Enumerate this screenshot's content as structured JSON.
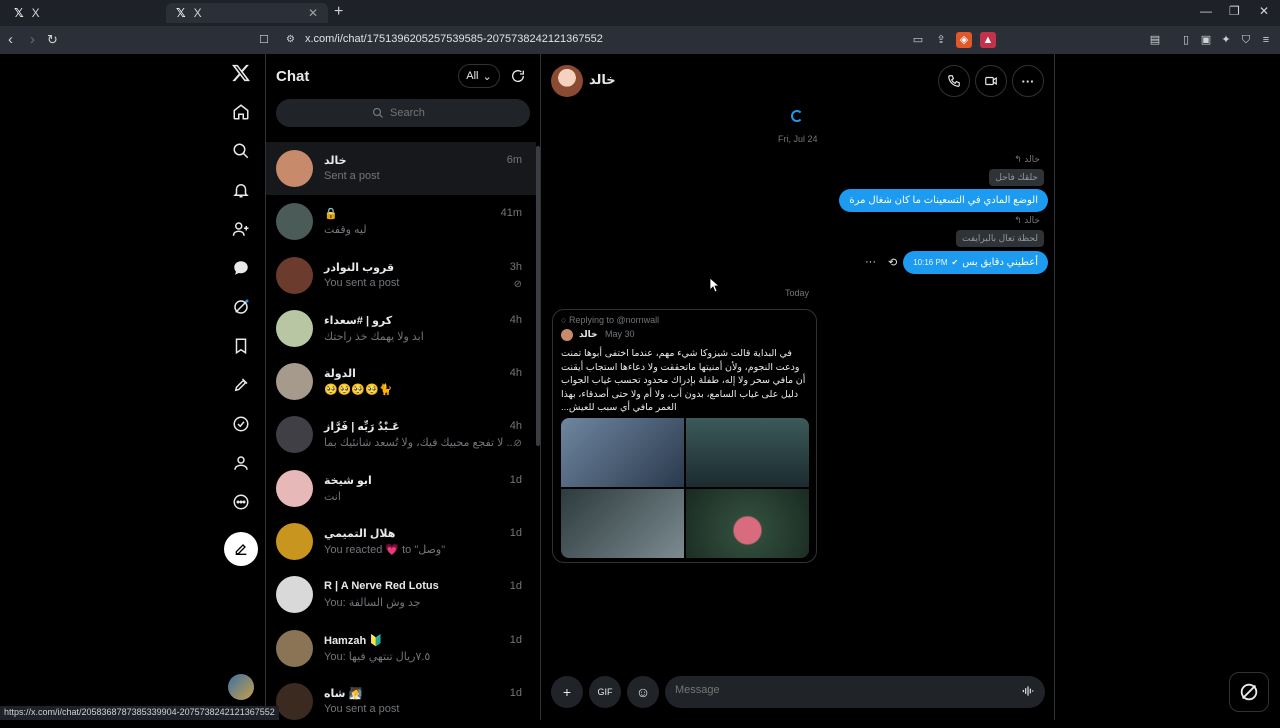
{
  "browser": {
    "tabs": [
      {
        "label": "X"
      },
      {
        "label": "X"
      }
    ],
    "url": "x.com/i/chat/1751396205257539585-2075738242121367552",
    "status_url": "https://x.com/i/chat/2058368787385339904-2075738242121367552"
  },
  "chatlist": {
    "title": "Chat",
    "filter": "All",
    "search_placeholder": "Search",
    "rows": [
      {
        "name": "خالد",
        "preview": "Sent a post",
        "time": "6m",
        "color": "#c78a6b"
      },
      {
        "name": "🔒",
        "preview": "ليه وقفت",
        "time": "41m",
        "color": "#4b5b58"
      },
      {
        "name": "قروب النوادر",
        "preview": "You sent a post",
        "time": "3h",
        "color": "#6b3b2d"
      },
      {
        "name": "كرو | #سعداء",
        "preview": "ابد ولا يهمك خذ راحتك",
        "time": "4h",
        "color": "#b9c6a4"
      },
      {
        "name": "الدولة",
        "preview": "🥺🥺🥺🥺🐈",
        "time": "4h",
        "color": "#a69a8c"
      },
      {
        "name": "عَـبْدُ رَبِّه | فَرَّاز",
        "preview": "لا تفجع محبيك فيك، ولا تُسعد شانئيك بما ...",
        "time": "4h",
        "color": "#3f3f45"
      },
      {
        "name": "ابو شيخة",
        "preview": "انت",
        "time": "1d",
        "color": "#e6b8b8"
      },
      {
        "name": "هلال التميمي",
        "preview": "You reacted 💗 to \"وصل\"",
        "time": "1d",
        "color": "#c8961e"
      },
      {
        "name": "R | A Nerve Red Lotus",
        "preview": "You: جد وش السالفة",
        "time": "1d",
        "color": "#d9d9d9"
      },
      {
        "name": "Hamzah 🔰",
        "preview": "You: ٧.٥ريال تنتهي فيها",
        "time": "1d",
        "color": "#8b7355"
      },
      {
        "name": "شاه 🧖",
        "preview": "You sent a post",
        "time": "1d",
        "color": "#3b2a20"
      }
    ]
  },
  "conversation": {
    "name": "خالد",
    "date1": "Fri, Jul 24",
    "reply_ctx1": "خالد",
    "quote1": "حلقك فاحل",
    "msg1": "الوضع المادي في التسعينات ما كان شغال مرة",
    "reply_ctx2": "خالد",
    "quote2": "لحظة تعال بالبرايفت",
    "msg2_time": "10:16 PM",
    "msg2": "أعطيني دقايق بس",
    "date2": "Today",
    "card": {
      "replying": "Replying to @nornwall",
      "author": "خالد",
      "date": "May 30",
      "text": "في البداية قالت شيزوكا شيء مهم، عندما اختفى أبوها تمنت ودعت النجوم، ولأن أمنيتها ماتحققت ولا دعاءها استجاب أيقنت أن مافي سحر ولا إله، طفلة بإدراك محدود تحسب غياب الجواب دليل على غياب السامع، بدون أب، ولا أم ولا حتى أصدقاء، بهذا العمر مافي أي سبب للعيش..."
    },
    "composer_placeholder": "Message"
  },
  "colors": {
    "accent": "#1d9bf0",
    "bg": "#000000",
    "border": "#2f3336",
    "muted": "#71767b"
  }
}
